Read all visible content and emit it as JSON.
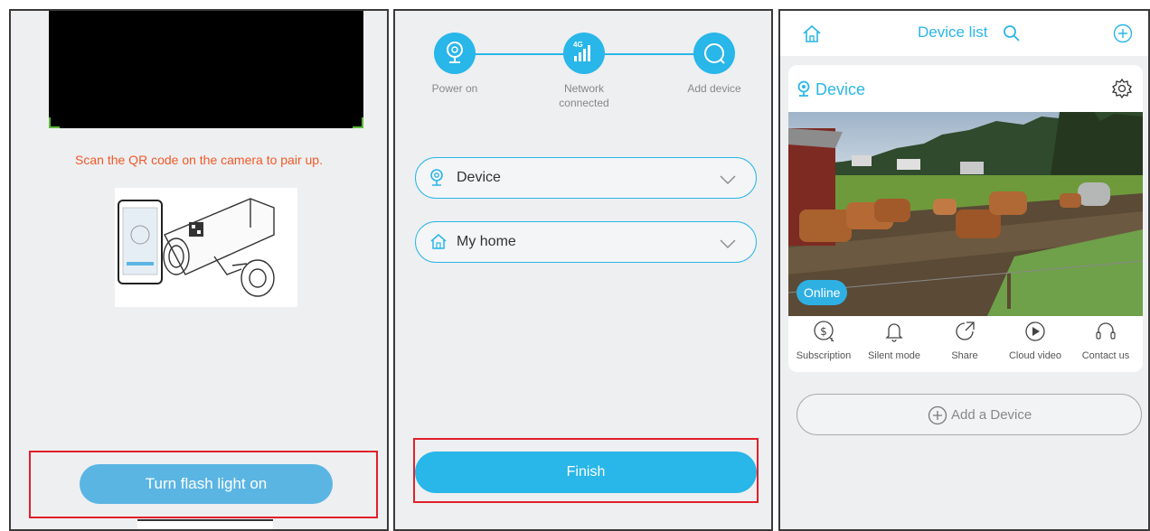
{
  "panel1": {
    "scan_instruction": "Scan the QR code on the camera to pair up.",
    "flash_button": "Turn flash light on"
  },
  "panel2": {
    "steps": [
      {
        "label": "Power on"
      },
      {
        "label": "Network connected",
        "badge": "4G"
      },
      {
        "label": "Add device"
      }
    ],
    "device_field": "Device",
    "home_field": "My home",
    "finish_button": "Finish"
  },
  "panel3": {
    "title": "Device list",
    "device_name": "Device",
    "status": "Online",
    "actions": [
      "Subscription",
      "Silent mode",
      "Share",
      "Cloud video",
      "Contact us"
    ],
    "add_device": "Add a Device"
  },
  "colors": {
    "accent": "#29b6e8",
    "warning_text": "#f05a28",
    "highlight_frame": "#e0202a"
  }
}
